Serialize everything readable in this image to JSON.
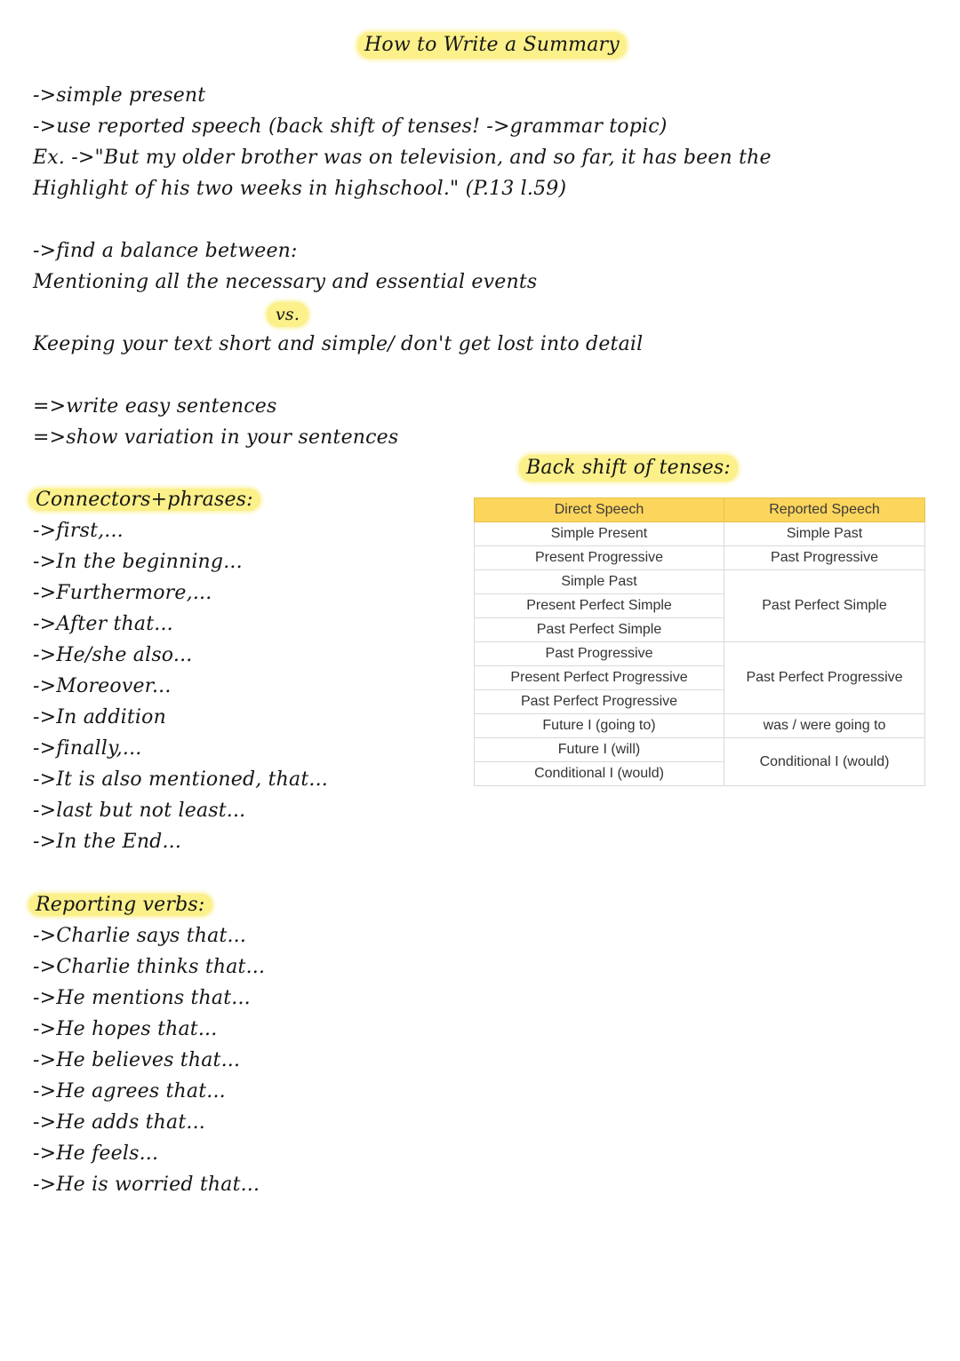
{
  "title": "How to Write a Summary",
  "intro": {
    "lines": [
      {
        "arrow": "->",
        "text": "simple present"
      },
      {
        "arrow": "->",
        "text": "use reported speech (back shift of tenses! ->grammar topic)"
      }
    ],
    "example_prefix": "Ex. ",
    "example_arrow": "->",
    "example_line1": "\"But my older brother was on television, and so far, it has been the",
    "example_line2": "Highlight of his two weeks in highschool.\" (P.13 l.59)"
  },
  "balance": {
    "arrow": "->",
    "heading": "find a balance between:",
    "option_a": "Mentioning all the necessary and essential events",
    "vs": "vs.",
    "option_b": "Keeping your text short and simple/ don't get lost into detail"
  },
  "tips": [
    {
      "arrow": "=>",
      "text": "write easy sentences"
    },
    {
      "arrow": "=>",
      "text": "show variation in your sentences"
    }
  ],
  "connectors": {
    "heading": "Connectors+phrases:",
    "items": [
      {
        "arrow": "->",
        "text": "first,..."
      },
      {
        "arrow": "->",
        "text": "In the beginning..."
      },
      {
        "arrow": "->",
        "text": "Furthermore,..."
      },
      {
        "arrow": "->",
        "text": "After that..."
      },
      {
        "arrow": "->",
        "text": "He/she also..."
      },
      {
        "arrow": "->",
        "text": "Moreover..."
      },
      {
        "arrow": "->",
        "text": "In addition"
      },
      {
        "arrow": "->",
        "text": "finally,..."
      },
      {
        "arrow": "->",
        "text": "It is also mentioned, that..."
      },
      {
        "arrow": "->",
        "text": "last but not least..."
      },
      {
        "arrow": "->",
        "text": "In the End..."
      }
    ]
  },
  "reporting_verbs": {
    "heading": "Reporting verbs:",
    "items": [
      {
        "arrow": "->",
        "text": "Charlie says that..."
      },
      {
        "arrow": "->",
        "text": "Charlie thinks that..."
      },
      {
        "arrow": "->",
        "text": "He mentions that..."
      },
      {
        "arrow": "->",
        "text": "He hopes that..."
      },
      {
        "arrow": "->",
        "text": "He believes that..."
      },
      {
        "arrow": "->",
        "text": "He agrees that..."
      },
      {
        "arrow": "->",
        "text": "He adds that..."
      },
      {
        "arrow": "->",
        "text": "He feels..."
      },
      {
        "arrow": "->",
        "text": "He is worried that..."
      }
    ]
  },
  "back_shift": {
    "heading": "Back shift of tenses:",
    "columns": [
      "Direct Speech",
      "Reported Speech"
    ],
    "direct": [
      "Simple Present",
      "Present Progressive",
      "Simple Past",
      "Present Perfect Simple",
      "Past Perfect Simple",
      "Past Progressive",
      "Present Perfect Progressive",
      "Past Perfect Progressive",
      "Future I (going to)",
      "Future I (will)",
      "Conditional I (would)"
    ],
    "reported": [
      "Simple Past",
      "Past Progressive",
      "Past Perfect Simple",
      "Past Perfect Progressive",
      "was / were going to",
      "Conditional I (would)"
    ]
  },
  "colors": {
    "highlight": "#fbf089",
    "table_header": "#fcd55c",
    "table_border": "#d9d9d9"
  }
}
